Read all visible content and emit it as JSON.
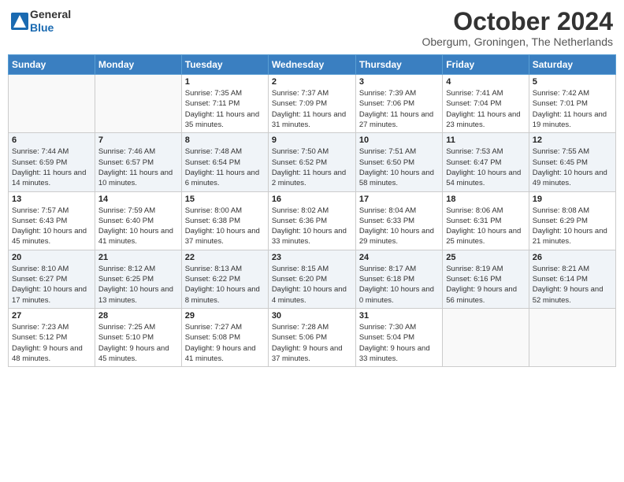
{
  "logo": {
    "general": "General",
    "blue": "Blue"
  },
  "title": "October 2024",
  "location": "Obergum, Groningen, The Netherlands",
  "days_of_week": [
    "Sunday",
    "Monday",
    "Tuesday",
    "Wednesday",
    "Thursday",
    "Friday",
    "Saturday"
  ],
  "weeks": [
    [
      {
        "day": "",
        "info": ""
      },
      {
        "day": "",
        "info": ""
      },
      {
        "day": "1",
        "info": "Sunrise: 7:35 AM\nSunset: 7:11 PM\nDaylight: 11 hours and 35 minutes."
      },
      {
        "day": "2",
        "info": "Sunrise: 7:37 AM\nSunset: 7:09 PM\nDaylight: 11 hours and 31 minutes."
      },
      {
        "day": "3",
        "info": "Sunrise: 7:39 AM\nSunset: 7:06 PM\nDaylight: 11 hours and 27 minutes."
      },
      {
        "day": "4",
        "info": "Sunrise: 7:41 AM\nSunset: 7:04 PM\nDaylight: 11 hours and 23 minutes."
      },
      {
        "day": "5",
        "info": "Sunrise: 7:42 AM\nSunset: 7:01 PM\nDaylight: 11 hours and 19 minutes."
      }
    ],
    [
      {
        "day": "6",
        "info": "Sunrise: 7:44 AM\nSunset: 6:59 PM\nDaylight: 11 hours and 14 minutes."
      },
      {
        "day": "7",
        "info": "Sunrise: 7:46 AM\nSunset: 6:57 PM\nDaylight: 11 hours and 10 minutes."
      },
      {
        "day": "8",
        "info": "Sunrise: 7:48 AM\nSunset: 6:54 PM\nDaylight: 11 hours and 6 minutes."
      },
      {
        "day": "9",
        "info": "Sunrise: 7:50 AM\nSunset: 6:52 PM\nDaylight: 11 hours and 2 minutes."
      },
      {
        "day": "10",
        "info": "Sunrise: 7:51 AM\nSunset: 6:50 PM\nDaylight: 10 hours and 58 minutes."
      },
      {
        "day": "11",
        "info": "Sunrise: 7:53 AM\nSunset: 6:47 PM\nDaylight: 10 hours and 54 minutes."
      },
      {
        "day": "12",
        "info": "Sunrise: 7:55 AM\nSunset: 6:45 PM\nDaylight: 10 hours and 49 minutes."
      }
    ],
    [
      {
        "day": "13",
        "info": "Sunrise: 7:57 AM\nSunset: 6:43 PM\nDaylight: 10 hours and 45 minutes."
      },
      {
        "day": "14",
        "info": "Sunrise: 7:59 AM\nSunset: 6:40 PM\nDaylight: 10 hours and 41 minutes."
      },
      {
        "day": "15",
        "info": "Sunrise: 8:00 AM\nSunset: 6:38 PM\nDaylight: 10 hours and 37 minutes."
      },
      {
        "day": "16",
        "info": "Sunrise: 8:02 AM\nSunset: 6:36 PM\nDaylight: 10 hours and 33 minutes."
      },
      {
        "day": "17",
        "info": "Sunrise: 8:04 AM\nSunset: 6:33 PM\nDaylight: 10 hours and 29 minutes."
      },
      {
        "day": "18",
        "info": "Sunrise: 8:06 AM\nSunset: 6:31 PM\nDaylight: 10 hours and 25 minutes."
      },
      {
        "day": "19",
        "info": "Sunrise: 8:08 AM\nSunset: 6:29 PM\nDaylight: 10 hours and 21 minutes."
      }
    ],
    [
      {
        "day": "20",
        "info": "Sunrise: 8:10 AM\nSunset: 6:27 PM\nDaylight: 10 hours and 17 minutes."
      },
      {
        "day": "21",
        "info": "Sunrise: 8:12 AM\nSunset: 6:25 PM\nDaylight: 10 hours and 13 minutes."
      },
      {
        "day": "22",
        "info": "Sunrise: 8:13 AM\nSunset: 6:22 PM\nDaylight: 10 hours and 8 minutes."
      },
      {
        "day": "23",
        "info": "Sunrise: 8:15 AM\nSunset: 6:20 PM\nDaylight: 10 hours and 4 minutes."
      },
      {
        "day": "24",
        "info": "Sunrise: 8:17 AM\nSunset: 6:18 PM\nDaylight: 10 hours and 0 minutes."
      },
      {
        "day": "25",
        "info": "Sunrise: 8:19 AM\nSunset: 6:16 PM\nDaylight: 9 hours and 56 minutes."
      },
      {
        "day": "26",
        "info": "Sunrise: 8:21 AM\nSunset: 6:14 PM\nDaylight: 9 hours and 52 minutes."
      }
    ],
    [
      {
        "day": "27",
        "info": "Sunrise: 7:23 AM\nSunset: 5:12 PM\nDaylight: 9 hours and 48 minutes."
      },
      {
        "day": "28",
        "info": "Sunrise: 7:25 AM\nSunset: 5:10 PM\nDaylight: 9 hours and 45 minutes."
      },
      {
        "day": "29",
        "info": "Sunrise: 7:27 AM\nSunset: 5:08 PM\nDaylight: 9 hours and 41 minutes."
      },
      {
        "day": "30",
        "info": "Sunrise: 7:28 AM\nSunset: 5:06 PM\nDaylight: 9 hours and 37 minutes."
      },
      {
        "day": "31",
        "info": "Sunrise: 7:30 AM\nSunset: 5:04 PM\nDaylight: 9 hours and 33 minutes."
      },
      {
        "day": "",
        "info": ""
      },
      {
        "day": "",
        "info": ""
      }
    ]
  ]
}
